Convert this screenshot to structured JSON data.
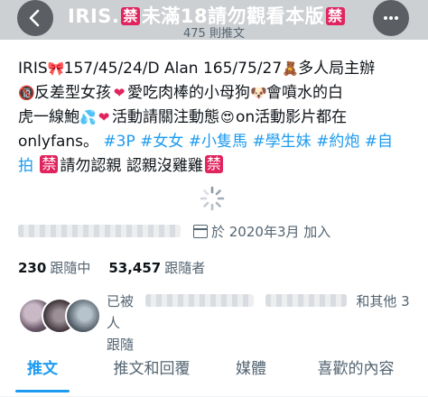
{
  "header": {
    "title_prefix": "IRIS.",
    "title_ban_1": "禁",
    "title_mid": "未滿18請勿觀看本版",
    "title_ban_2": "禁",
    "tweet_count": "475 則推文"
  },
  "bio": {
    "line1": "IRIS",
    "line1b": "157/45/24/D Alan 165/75/27",
    "line1c": "多人局主辦",
    "line2a": "反差型女孩",
    "line2b": "愛吃肉棒的小母狗",
    "line2c": "會噴水的白",
    "line3a": "虎一線鮑",
    "line3b": "活動請關注動態",
    "line3c": "on活動影片都在",
    "line4a": "onlyfans。",
    "hashtags": [
      "#3P",
      "#女女",
      "#小隻馬",
      "#學生妹",
      "#約炮",
      "#自"
    ],
    "line5_tag": "拍",
    "ban_1": "禁",
    "line5_text": "請勿認親 認親沒雞雞",
    "ban_2": "禁"
  },
  "meta": {
    "joined": "於 2020年3月 加入"
  },
  "follow": {
    "following_count": "230",
    "following_label": "跟隨中",
    "followers_count": "53,457",
    "followers_label": "跟隨者"
  },
  "followed_by": {
    "prefix": "已被",
    "suffix": "和其他 3 人",
    "line2": "跟隨"
  },
  "tabs": [
    "推文",
    "推文和回覆",
    "媒體",
    "喜歡的內容"
  ],
  "colors": {
    "accent": "#1d9bf0",
    "ban_badge": "#e0245e",
    "secondary_text": "#536471"
  },
  "icons": [
    "back-arrow-icon",
    "more-icon",
    "calendar-icon",
    "loading-spinner-icon"
  ]
}
